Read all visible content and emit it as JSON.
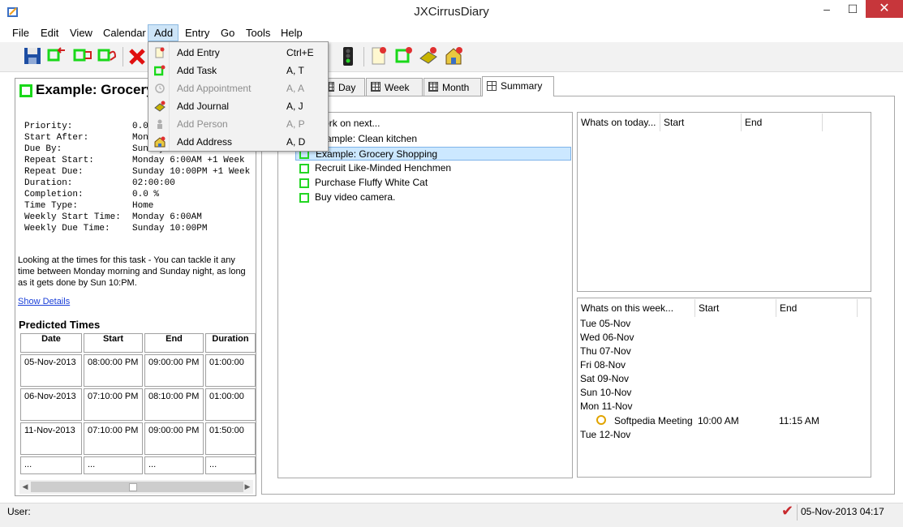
{
  "window": {
    "title": "JXCirrusDiary",
    "minimize_glyph": "–",
    "maximize_glyph": "☐",
    "close_glyph": "✕"
  },
  "menubar": [
    "File",
    "Edit",
    "View",
    "Calendar",
    "Add",
    "Entry",
    "Go",
    "Tools",
    "Help"
  ],
  "add_menu": {
    "items": [
      {
        "label": "Add Entry",
        "shortcut": "Ctrl+E",
        "enabled": true,
        "icon": "entry-icon"
      },
      {
        "label": "Add Task",
        "shortcut": "A, T",
        "enabled": true,
        "icon": "task-icon"
      },
      {
        "label": "Add Appointment",
        "shortcut": "A, A",
        "enabled": false,
        "icon": "appointment-icon"
      },
      {
        "label": "Add Journal",
        "shortcut": "A, J",
        "enabled": true,
        "icon": "journal-icon"
      },
      {
        "label": "Add Person",
        "shortcut": "A, P",
        "enabled": false,
        "icon": "person-icon"
      },
      {
        "label": "Add Address",
        "shortcut": "A, D",
        "enabled": true,
        "icon": "address-icon"
      }
    ]
  },
  "left_panel": {
    "title": "Example: Grocery Shopping",
    "properties": [
      {
        "label": "Priority:",
        "value": "0.0"
      },
      {
        "label": "Start After:",
        "value": "Monday 6:00AM"
      },
      {
        "label": "Due By:",
        "value": "Sunday 10:00PM"
      },
      {
        "label": "Repeat Start:",
        "value": "Monday 6:00AM +1 Week"
      },
      {
        "label": "Repeat Due:",
        "value": "Sunday 10:00PM +1 Week"
      },
      {
        "label": "Duration:",
        "value": "02:00:00"
      },
      {
        "label": "Completion:",
        "value": "0.0 %"
      },
      {
        "label": "Time Type:",
        "value": "Home"
      },
      {
        "label": "Weekly Start Time:",
        "value": "Monday 6:00AM"
      },
      {
        "label": "Weekly Due Time:",
        "value": "Sunday 10:00PM"
      }
    ],
    "description": "Looking at the times for this task - You can tackle it any time between Monday morning and Sunday night, as long as it gets done by Sun 10:PM.",
    "show_details": "Show Details",
    "predicted_title": "Predicted Times",
    "predicted_headers": [
      "Date",
      "Start",
      "End",
      "Duration"
    ],
    "predicted_rows": [
      [
        "05-Nov-2013",
        "08:00:00 PM",
        "09:00:00 PM",
        "01:00:00"
      ],
      [
        "06-Nov-2013",
        "07:10:00 PM",
        "08:10:00 PM",
        "01:00:00"
      ],
      [
        "11-Nov-2013",
        "07:10:00 PM",
        "09:00:00 PM",
        "01:50:00"
      ],
      [
        "...",
        "...",
        "...",
        "..."
      ]
    ]
  },
  "tabs": [
    "Day",
    "Week",
    "Month",
    "Summary"
  ],
  "work_on_next": {
    "header": "Work on next...",
    "items": [
      {
        "label": "Example: Clean kitchen",
        "selected": false
      },
      {
        "label": "Example: Grocery Shopping",
        "selected": true
      },
      {
        "label": "Recruit Like-Minded Henchmen",
        "selected": false
      },
      {
        "label": "Purchase Fluffy White Cat",
        "selected": false
      },
      {
        "label": "Buy video camera.",
        "selected": false
      }
    ]
  },
  "today": {
    "headers": [
      "Whats on today...",
      "Start",
      "End"
    ]
  },
  "week": {
    "headers": [
      "Whats on this week...",
      "Start",
      "End"
    ],
    "days": [
      "Tue 05-Nov",
      "Wed 06-Nov",
      "Thu 07-Nov",
      "Fri 08-Nov",
      "Sat 09-Nov",
      "Sun 10-Nov",
      "Mon 11-Nov"
    ],
    "event": {
      "title": "Softpedia Meeting",
      "start": "10:00 AM",
      "end": "11:15 AM"
    },
    "last_day": "Tue 12-Nov"
  },
  "statusbar": {
    "user_label": "User:",
    "datetime": "05-Nov-2013 04:17",
    "check_glyph": "✔"
  },
  "colors": {
    "accent_blue": "#cde4f7",
    "task_green": "#19d819",
    "close_red": "#c7363b",
    "link_blue": "#1a3fd8"
  }
}
